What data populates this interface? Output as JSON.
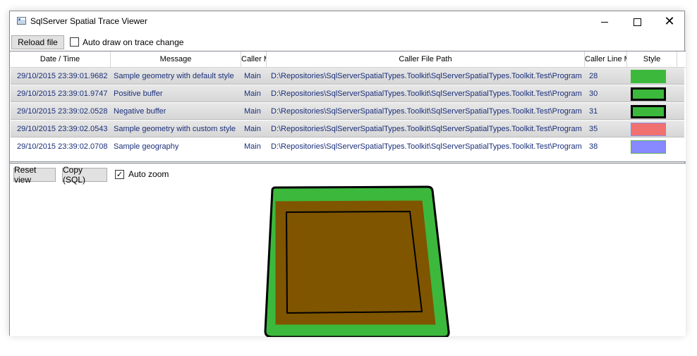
{
  "window": {
    "title": "SqlServer Spatial Trace Viewer",
    "controls": {
      "minimize": "minimize",
      "maximize": "maximize",
      "close": "close"
    }
  },
  "toolbar": {
    "reload_label": "Reload file",
    "auto_draw_label": "Auto draw on trace change",
    "auto_draw_checked": false
  },
  "grid": {
    "columns": [
      "Date / Time",
      "Message",
      "Caller M",
      "Caller File Path",
      "Caller Line M",
      "Style"
    ],
    "rows": [
      {
        "datetime": "29/10/2015 23:39:01.9682",
        "message": "Sample geometry with default style",
        "caller_member": "Main",
        "caller_file_path": "D:\\Repositories\\SqlServerSpatialTypes.Toolkit\\SqlServerSpatialTypes.Toolkit.Test\\Program.cs",
        "caller_line": "28",
        "style": {
          "fill": "#3cb93c",
          "stroke": "#3cb93c",
          "stroke_width": 1
        },
        "selected": true
      },
      {
        "datetime": "29/10/2015 23:39:01.9747",
        "message": "Positive buffer",
        "caller_member": "Main",
        "caller_file_path": "D:\\Repositories\\SqlServerSpatialTypes.Toolkit\\SqlServerSpatialTypes.Toolkit.Test\\Program.cs",
        "caller_line": "30",
        "style": {
          "fill": "#3cb93c",
          "stroke": "#000000",
          "stroke_width": 3
        },
        "selected": true
      },
      {
        "datetime": "29/10/2015 23:39:02.0528",
        "message": "Negative buffer",
        "caller_member": "Main",
        "caller_file_path": "D:\\Repositories\\SqlServerSpatialTypes.Toolkit\\SqlServerSpatialTypes.Toolkit.Test\\Program.cs",
        "caller_line": "31",
        "style": {
          "fill": "#3cb93c",
          "stroke": "#000000",
          "stroke_width": 3
        },
        "selected": true
      },
      {
        "datetime": "29/10/2015 23:39:02.0543",
        "message": "Sample geometry with custom style",
        "caller_member": "Main",
        "caller_file_path": "D:\\Repositories\\SqlServerSpatialTypes.Toolkit\\SqlServerSpatialTypes.Toolkit.Test\\Program.cs",
        "caller_line": "35",
        "style": {
          "fill": "#f07070",
          "stroke": "#8a8adf",
          "stroke_width": 1
        },
        "selected": true
      },
      {
        "datetime": "29/10/2015 23:39:02.0708",
        "message": "Sample geography",
        "caller_member": "Main",
        "caller_file_path": "D:\\Repositories\\SqlServerSpatialTypes.Toolkit\\SqlServerSpatialTypes.Toolkit.Test\\Program.cs",
        "caller_line": "38",
        "style": {
          "fill": "#8888ff",
          "stroke": "#5ab05a",
          "stroke_width": 1
        },
        "selected": false
      }
    ]
  },
  "viewer": {
    "reset_label": "Reset view",
    "copy_label": "Copy (SQL)",
    "auto_zoom_label": "Auto zoom",
    "auto_zoom_checked": true
  },
  "colors": {
    "outer_buffer_fill": "#3cb93c",
    "geometry_fill": "#7f5500",
    "outline": "#000000",
    "row_text": "#1a2f7a"
  }
}
